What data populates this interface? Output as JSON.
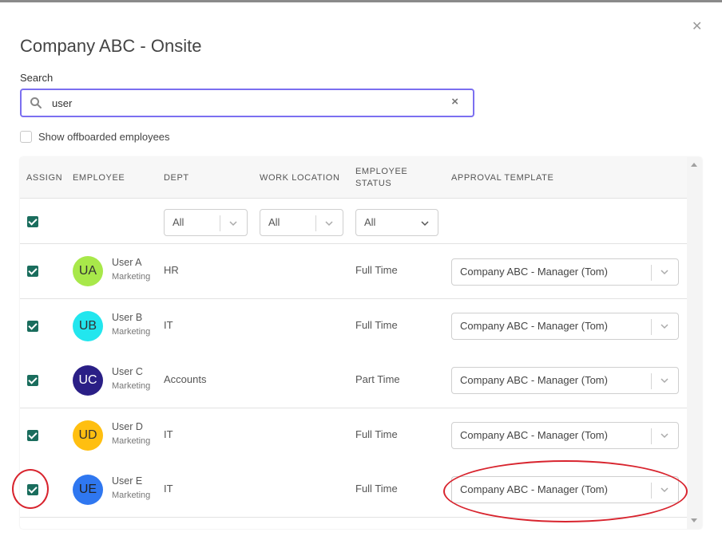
{
  "dialog": {
    "title": "Company ABC - Onsite",
    "close_icon": "close-icon"
  },
  "search": {
    "label": "Search",
    "value": "user",
    "icon": "search-icon",
    "clear": "×"
  },
  "offboarded": {
    "label": "Show offboarded employees",
    "checked": false
  },
  "table": {
    "headers": {
      "assign": "ASSIGN",
      "employee": "EMPLOYEE",
      "dept": "DEPT",
      "work_location": "WORK LOCATION",
      "employee_status_1": "EMPLOYEE",
      "employee_status_2": "STATUS",
      "approval_template": "APPROVAL TEMPLATE"
    },
    "filters": {
      "dept": "All",
      "work_location": "All",
      "employee_status": "All"
    },
    "rows": [
      {
        "initials": "UA",
        "name": "User A",
        "group": "Marketing",
        "dept": "HR",
        "location": "",
        "status": "Full Time",
        "template": "Company ABC - Manager (Tom)",
        "assigned": true,
        "avatar_color": "#a8e84a",
        "avatar_text": "#333333"
      },
      {
        "initials": "UB",
        "name": "User B",
        "group": "Marketing",
        "dept": "IT",
        "location": "",
        "status": "Full Time",
        "template": "Company ABC - Manager (Tom)",
        "assigned": true,
        "avatar_color": "#22e6ee",
        "avatar_text": "#333333"
      },
      {
        "initials": "UC",
        "name": "User C",
        "group": "Marketing",
        "dept": "Accounts",
        "location": "",
        "status": "Part Time",
        "template": "Company ABC - Manager (Tom)",
        "assigned": true,
        "avatar_color": "#2a1f86",
        "avatar_text": "#ffffff"
      },
      {
        "initials": "UD",
        "name": "User D",
        "group": "Marketing",
        "dept": "IT",
        "location": "",
        "status": "Full Time",
        "template": "Company ABC - Manager (Tom)",
        "assigned": true,
        "avatar_color": "#ffbf10",
        "avatar_text": "#333333"
      },
      {
        "initials": "UE",
        "name": "User E",
        "group": "Marketing",
        "dept": "IT",
        "location": "",
        "status": "Full Time",
        "template": "Company ABC - Manager (Tom)",
        "assigned": true,
        "avatar_color": "#2f77f0",
        "avatar_text": "#222222"
      }
    ]
  },
  "colors": {
    "accent": "#7b6ff0",
    "checkbox": "#1a6d5d",
    "annotation": "#d8242e"
  }
}
